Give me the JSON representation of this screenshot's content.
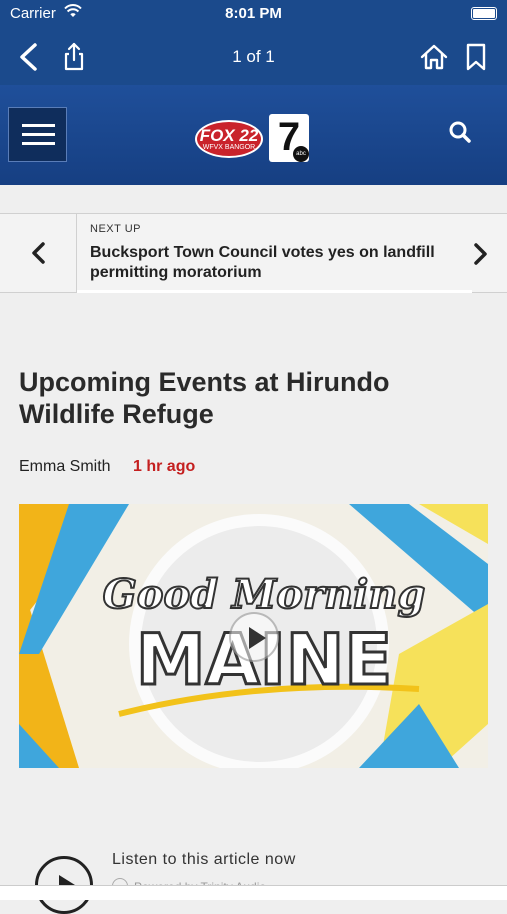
{
  "status_bar": {
    "carrier": "Carrier",
    "time": "8:01 PM"
  },
  "nav": {
    "page_count": "1 of 1"
  },
  "site": {
    "logo_fox": "FOX 22",
    "logo_fox_sub": "WFVX BANGOR",
    "logo_seven": "7",
    "logo_abc": "abc"
  },
  "next_up": {
    "label": "NEXT UP",
    "headline": "Bucksport Town Council votes yes on landfill permitting moratorium"
  },
  "article": {
    "title": "Upcoming Events at Hirundo Wildlife Refuge",
    "author": "Emma Smith",
    "time_ago": "1 hr ago",
    "video_logo_line1": "Good Morning",
    "video_logo_line2": "MAINE"
  },
  "audio": {
    "listen_label": "Listen to this article now",
    "powered_by": "Powered by Trinity Audio"
  },
  "colors": {
    "nav_bg": "#1b4a8c",
    "accent_red": "#c41f1f"
  }
}
